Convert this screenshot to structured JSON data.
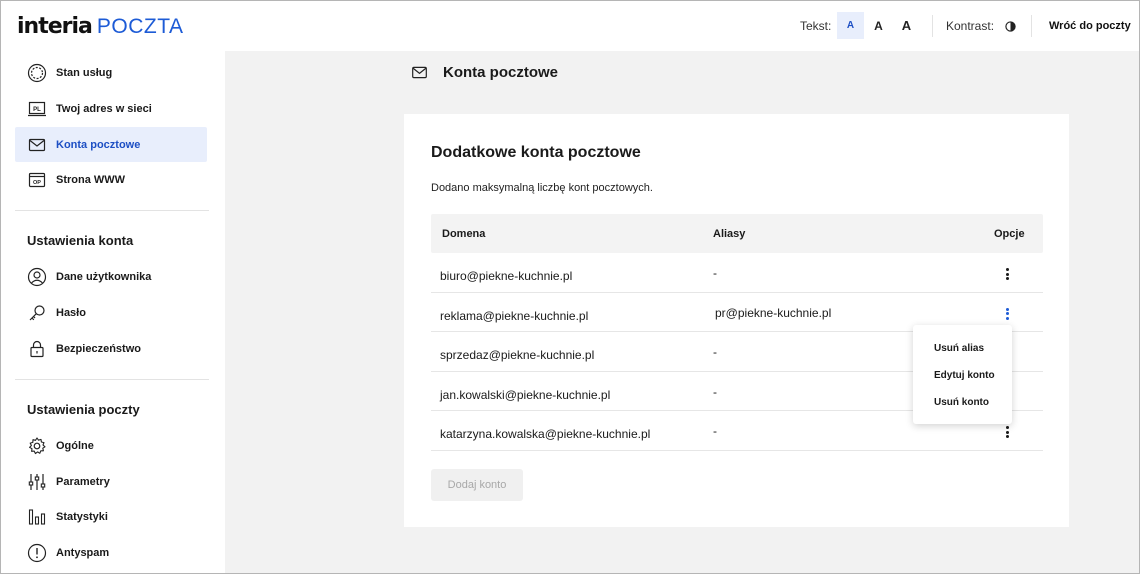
{
  "header": {
    "logo_brand": "interia",
    "logo_product": "POCZTA",
    "text_label": "Tekst:",
    "text_sizes": [
      "A",
      "A",
      "A"
    ],
    "contrast_label": "Kontrast:",
    "back_button": "Wróć do poczty"
  },
  "sidebar": {
    "main_items": [
      {
        "label": "Stan usług",
        "icon": "service-status-icon"
      },
      {
        "label": "Twoj adres w sieci",
        "icon": "web-address-icon",
        "icon_text": "PL"
      },
      {
        "label": "Konta pocztowe",
        "icon": "mail-icon",
        "active": true
      },
      {
        "label": "Strona WWW",
        "icon": "website-icon",
        "icon_text": "OP"
      }
    ],
    "account_heading": "Ustawienia konta",
    "account_items": [
      {
        "label": "Dane użytkownika",
        "icon": "user-icon"
      },
      {
        "label": "Hasło",
        "icon": "key-icon"
      },
      {
        "label": "Bezpieczeństwo",
        "icon": "lock-icon"
      }
    ],
    "mail_heading": "Ustawienia poczty",
    "mail_items": [
      {
        "label": "Ogólne",
        "icon": "gear-icon"
      },
      {
        "label": "Parametry",
        "icon": "sliders-icon"
      },
      {
        "label": "Statystyki",
        "icon": "stats-icon"
      },
      {
        "label": "Antyspam",
        "icon": "warning-icon"
      }
    ]
  },
  "main": {
    "page_title": "Konta pocztowe",
    "card_title": "Dodatkowe konta pocztowe",
    "info": "Dodano maksymalną liczbę kont pocztowych.",
    "columns": [
      "Domena",
      "Aliasy",
      "Opcje"
    ],
    "rows": [
      {
        "domain": "biuro@piekne-kuchnie.pl",
        "alias": "-"
      },
      {
        "domain": "reklama@piekne-kuchnie.pl",
        "alias": "pr@piekne-kuchnie.pl"
      },
      {
        "domain": "sprzedaz@piekne-kuchnie.pl",
        "alias": "-"
      },
      {
        "domain": "jan.kowalski@piekne-kuchnie.pl",
        "alias": "-"
      },
      {
        "domain": "katarzyna.kowalska@piekne-kuchnie.pl",
        "alias": "-"
      }
    ],
    "context_menu": [
      "Usuń alias",
      "Edytuj konto",
      "Usuń konto"
    ],
    "add_button": "Dodaj konto"
  },
  "colors": {
    "accent": "#1d5bd6",
    "active_bg": "#e8eefc",
    "page_bg": "#f2f2f2"
  }
}
